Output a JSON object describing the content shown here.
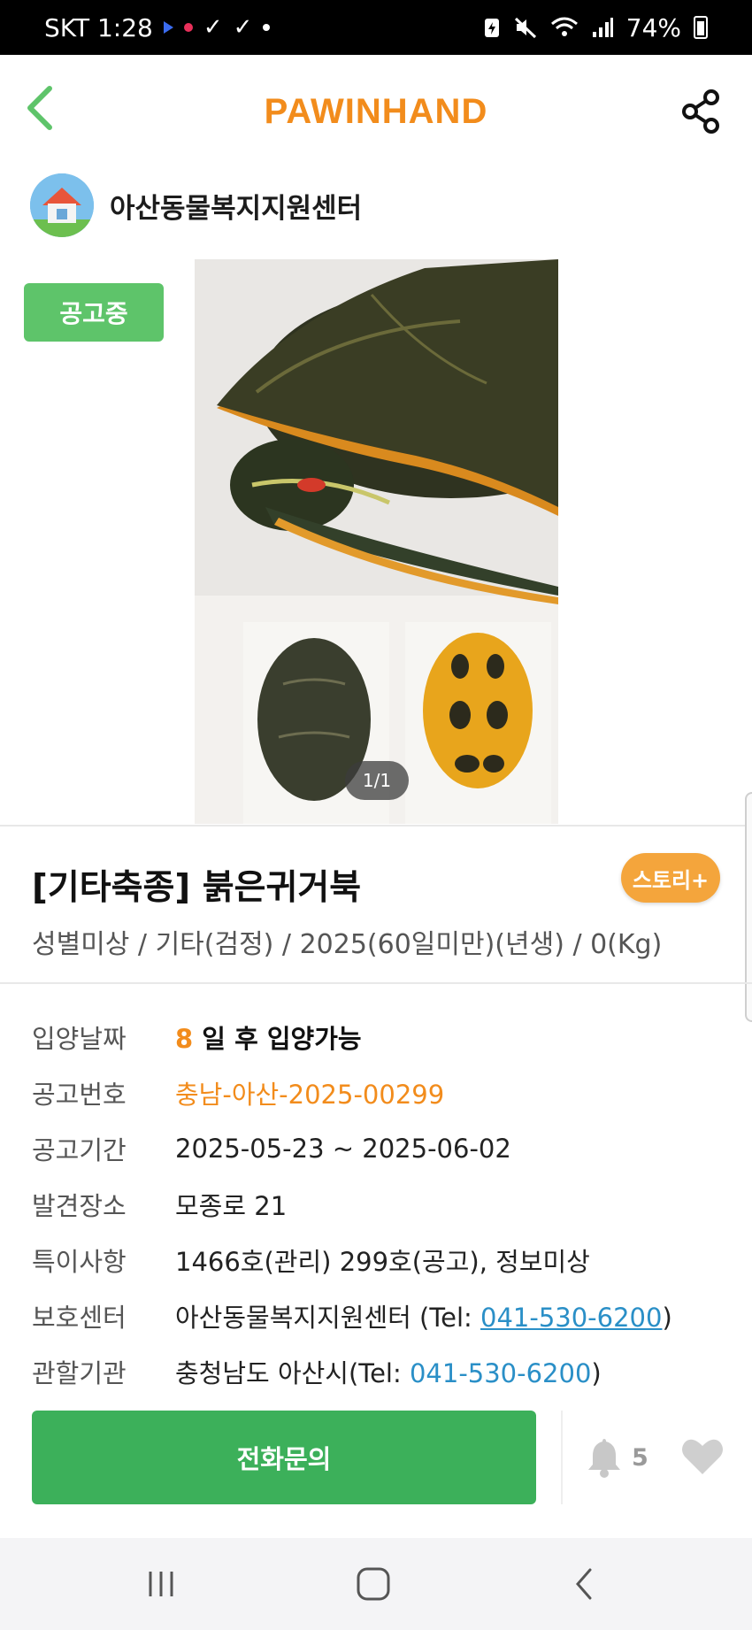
{
  "status_bar": {
    "carrier_time": "SKT 1:28",
    "battery": "74%"
  },
  "header": {
    "brand": "PAWINHAND"
  },
  "shelter": {
    "name": "아산동물복지지원센터"
  },
  "notice_badge": "공고중",
  "photo": {
    "counter": "1/1"
  },
  "animal": {
    "title": "[기타축종] 붉은귀거북",
    "story_badge": "스토리+",
    "summary": "성별미상 / 기타(검정) / 2025(60일미만)(년생) / 0(Kg)"
  },
  "info": {
    "adoption_label": "입양날짜",
    "adoption_days": "8",
    "adoption_text": "일 후 입양가능",
    "notice_no_label": "공고번호",
    "notice_no": "충남-아산-2025-00299",
    "period_label": "공고기간",
    "period": "2025-05-23 ~ 2025-06-02",
    "found_label": "발견장소",
    "found": "모종로 21",
    "special_label": "특이사항",
    "special": "1466호(관리) 299호(공고), 정보미상",
    "center_label": "보호센터",
    "center_prefix": "아산동물복지지원센터 (Tel: ",
    "center_tel": "041-530-6200",
    "center_suffix": ")",
    "agency_label": "관할기관",
    "agency_prefix": "충청남도 아산시(Tel: ",
    "agency_tel": "041-530-6200",
    "agency_suffix": ")"
  },
  "actions": {
    "call_label": "전화문의",
    "alarm_count": "5"
  },
  "colors": {
    "brand_orange": "#f28c1c",
    "green": "#3cb05a",
    "badge_green": "#5ec46a",
    "link_blue": "#2a8fc7"
  }
}
